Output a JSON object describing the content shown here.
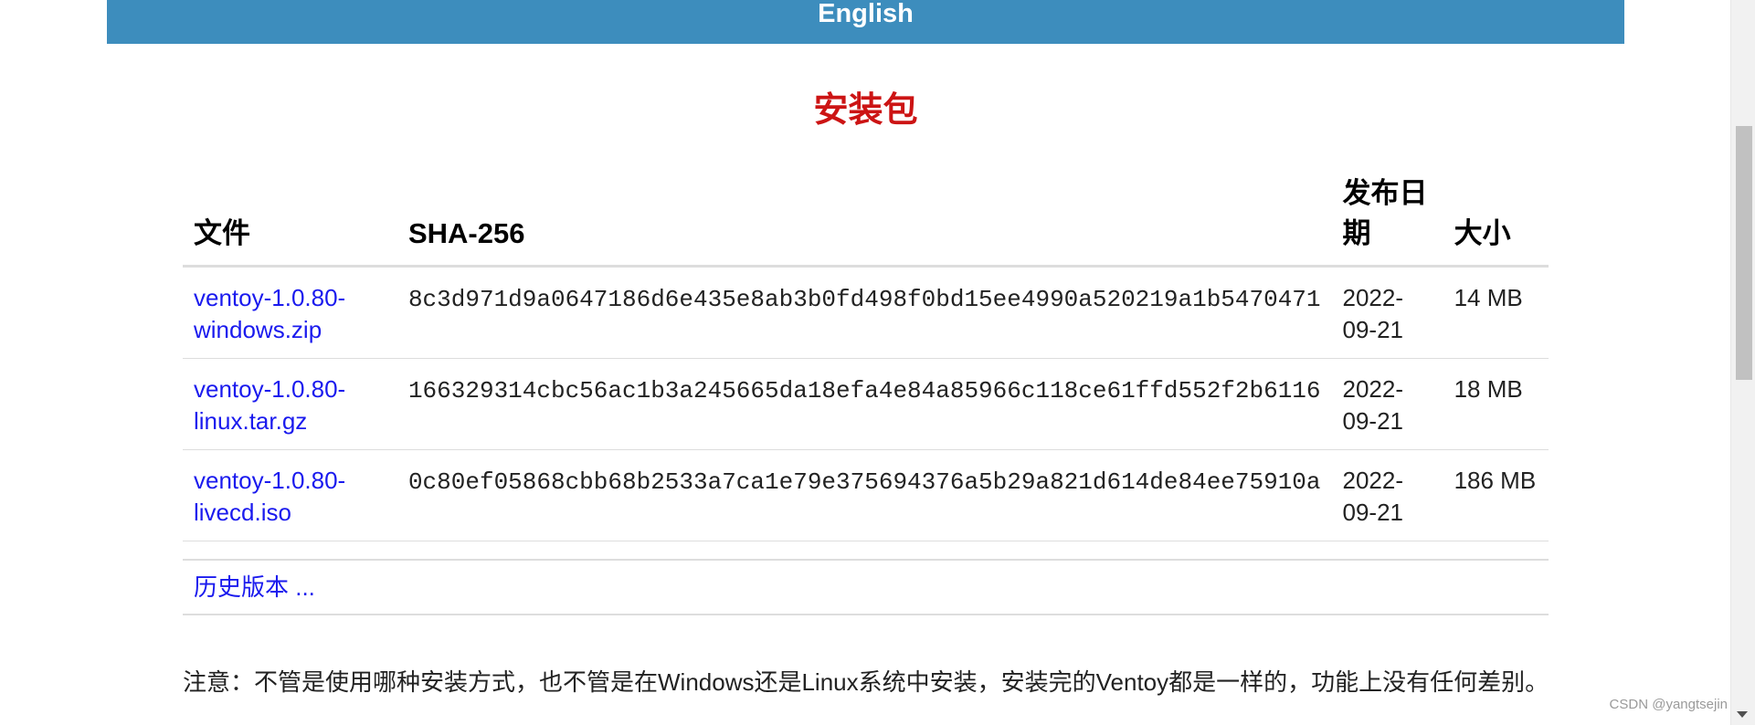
{
  "banner": {
    "label": "English"
  },
  "section": {
    "title": "安装包"
  },
  "table": {
    "headers": {
      "file": "文件",
      "sha": "SHA-256",
      "date": "发布日期",
      "size": "大小"
    },
    "rows": [
      {
        "file": "ventoy-1.0.80-windows.zip",
        "sha": "8c3d971d9a0647186d6e435e8ab3b0fd498f0bd15ee4990a520219a1b5470471",
        "date": "2022-09-21",
        "size": "14 MB"
      },
      {
        "file": "ventoy-1.0.80-linux.tar.gz",
        "sha": "166329314cbc56ac1b3a245665da18efa4e84a85966c118ce61ffd552f2b6116",
        "date": "2022-09-21",
        "size": "18 MB"
      },
      {
        "file": "ventoy-1.0.80-livecd.iso",
        "sha": "0c80ef05868cbb68b2533a7ca1e79e375694376a5b29a821d614de84ee75910a",
        "date": "2022-09-21",
        "size": "186 MB"
      }
    ]
  },
  "history": {
    "label": "历史版本 ..."
  },
  "note": {
    "text": "注意：不管是使用哪种安装方式，也不管是在Windows还是Linux系统中安装，安装完的Ventoy都是一样的，功能上没有任何差别。"
  },
  "watermark": {
    "text": "CSDN @yangtsejin"
  },
  "colors": {
    "banner_bg": "#3d8dbd",
    "title_red": "#cc1414",
    "link_blue": "#1a1aee"
  }
}
